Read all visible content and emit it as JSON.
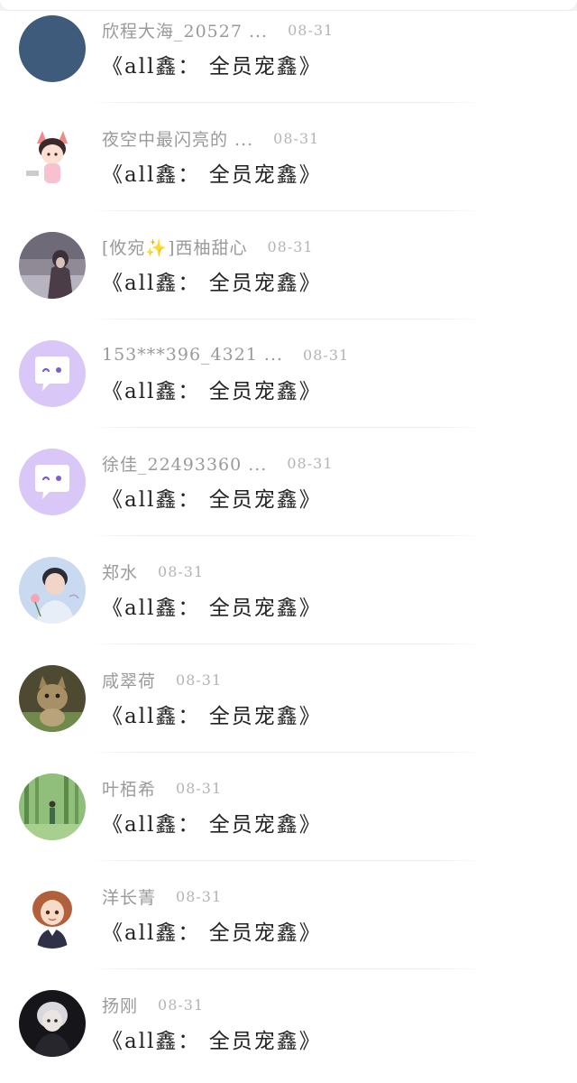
{
  "messages": [
    {
      "username": "欣程大海_20527 ...",
      "date": "08-31",
      "text": "《all鑫： 全员宠鑫》",
      "avatar": "dark-blue-solid"
    },
    {
      "username": "夜空中最闪亮的 ...",
      "date": "08-31",
      "text": "《all鑫： 全员宠鑫》",
      "avatar": "anime-boy-fox-ears"
    },
    {
      "username": "[攸宛✨]西柚甜心",
      "date": "08-31",
      "text": "《all鑫： 全员宠鑫》",
      "avatar": "girl-in-forest"
    },
    {
      "username": "153***396_4321 ...",
      "date": "08-31",
      "text": "《all鑫： 全员宠鑫》",
      "avatar": "default-chat-bubble"
    },
    {
      "username": "徐佳_22493360 ...",
      "date": "08-31",
      "text": "《all鑫： 全员宠鑫》",
      "avatar": "default-chat-bubble"
    },
    {
      "username": "郑水",
      "date": "08-31",
      "text": "《all鑫： 全员宠鑫》",
      "avatar": "young-man-with-flower"
    },
    {
      "username": "咸翠荷",
      "date": "08-31",
      "text": "《all鑫： 全员宠鑫》",
      "avatar": "kitten-photo"
    },
    {
      "username": "叶栢希",
      "date": "08-31",
      "text": "《all鑫： 全员宠鑫》",
      "avatar": "person-in-green-forest"
    },
    {
      "username": "洋长菁",
      "date": "08-31",
      "text": "《all鑫： 全员宠鑫》",
      "avatar": "doll-girl-auburn-hair"
    },
    {
      "username": "扬刚",
      "date": "08-31",
      "text": "《all鑫： 全员宠鑫》",
      "avatar": "anime-silver-hair-dark"
    }
  ],
  "colors": {
    "username": "#9a9a9a",
    "date": "#b4b4b4",
    "message": "#222222",
    "default_avatar_bg": "#d9c8f7"
  }
}
